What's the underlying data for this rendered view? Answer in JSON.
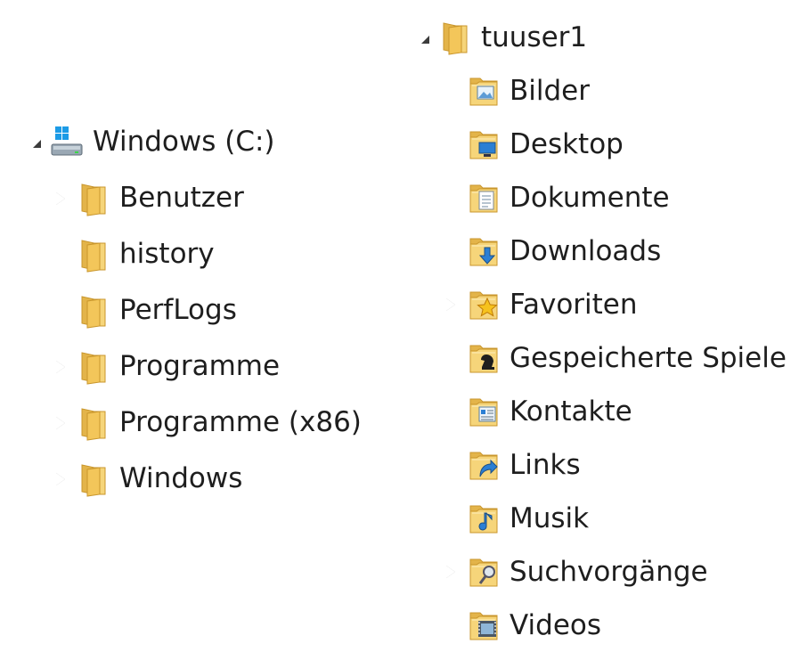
{
  "left_tree": {
    "root": {
      "label": "Windows (C:)",
      "expanded": true,
      "icon": "drive-icon"
    },
    "items": [
      {
        "label": "Benutzer",
        "name": "tree-item-benutzer",
        "expander": "collapsed",
        "icon": "folder-icon"
      },
      {
        "label": "history",
        "name": "tree-item-history",
        "expander": "none",
        "icon": "folder-icon"
      },
      {
        "label": "PerfLogs",
        "name": "tree-item-perflogs",
        "expander": "none",
        "icon": "folder-icon"
      },
      {
        "label": "Programme",
        "name": "tree-item-programme",
        "expander": "collapsed",
        "icon": "folder-icon"
      },
      {
        "label": "Programme (x86)",
        "name": "tree-item-programme-x86",
        "expander": "collapsed",
        "icon": "folder-icon"
      },
      {
        "label": "Windows",
        "name": "tree-item-windows",
        "expander": "collapsed",
        "icon": "folder-icon"
      }
    ]
  },
  "right_tree": {
    "root": {
      "label": "tuuser1",
      "expanded": true,
      "icon": "user-folder-icon"
    },
    "items": [
      {
        "label": "Bilder",
        "name": "tree-item-bilder",
        "expander": "none",
        "icon": "pictures-folder-icon"
      },
      {
        "label": "Desktop",
        "name": "tree-item-desktop",
        "expander": "none",
        "icon": "desktop-folder-icon"
      },
      {
        "label": "Dokumente",
        "name": "tree-item-dokumente",
        "expander": "none",
        "icon": "documents-folder-icon"
      },
      {
        "label": "Downloads",
        "name": "tree-item-downloads",
        "expander": "none",
        "icon": "downloads-folder-icon"
      },
      {
        "label": "Favoriten",
        "name": "tree-item-favoriten",
        "expander": "collapsed",
        "icon": "favorites-folder-icon"
      },
      {
        "label": "Gespeicherte Spiele",
        "name": "tree-item-gespeicherte-spiele",
        "expander": "none",
        "icon": "saved-games-folder-icon"
      },
      {
        "label": "Kontakte",
        "name": "tree-item-kontakte",
        "expander": "none",
        "icon": "contacts-folder-icon"
      },
      {
        "label": "Links",
        "name": "tree-item-links",
        "expander": "none",
        "icon": "links-folder-icon"
      },
      {
        "label": "Musik",
        "name": "tree-item-musik",
        "expander": "none",
        "icon": "music-folder-icon"
      },
      {
        "label": "Suchvorgänge",
        "name": "tree-item-suchvorgaenge",
        "expander": "collapsed",
        "icon": "searches-folder-icon"
      },
      {
        "label": "Videos",
        "name": "tree-item-videos",
        "expander": "none",
        "icon": "videos-folder-icon"
      }
    ]
  },
  "colors": {
    "folder_back": "#e3b44a",
    "folder_front": "#f6d57a",
    "folder_edge": "#c9962c",
    "expander_filled": "#3c3c3c",
    "expander_outline": "#9a9a9a",
    "text": "#1e1e1e",
    "accent_blue": "#2b7fd4"
  }
}
